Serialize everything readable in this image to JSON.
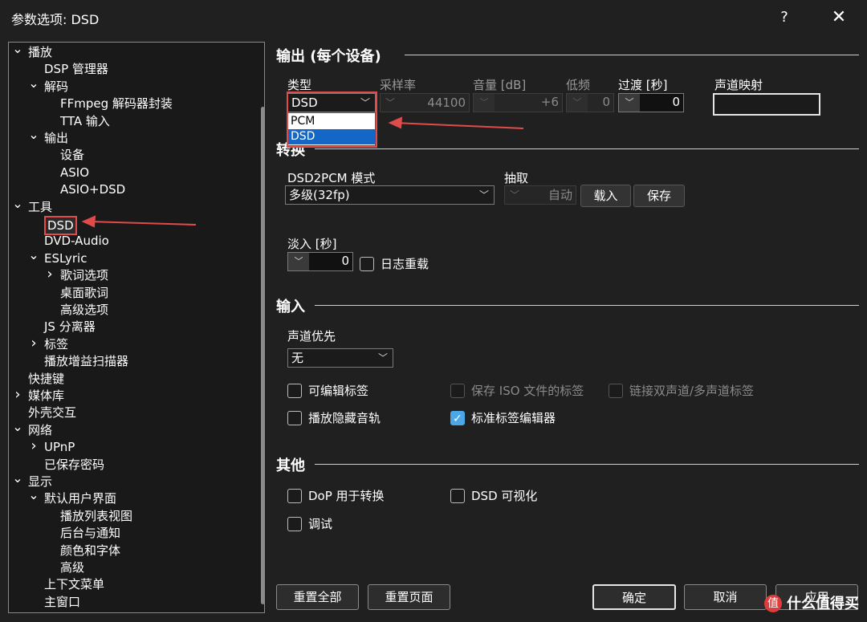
{
  "window": {
    "title": "参数选项: DSD",
    "help": "?",
    "close": "✕"
  },
  "tree": [
    {
      "label": "播放",
      "toggle": "expanded"
    },
    {
      "label": "DSP 管理器",
      "toggle": ""
    },
    {
      "label": "解码",
      "toggle": "expanded"
    },
    {
      "label": "FFmpeg 解码器封装",
      "toggle": ""
    },
    {
      "label": "TTA 输入",
      "toggle": ""
    },
    {
      "label": "输出",
      "toggle": "expanded"
    },
    {
      "label": "设备",
      "toggle": ""
    },
    {
      "label": "ASIO",
      "toggle": ""
    },
    {
      "label": "ASIO+DSD",
      "toggle": ""
    },
    {
      "label": "工具",
      "toggle": "expanded"
    },
    {
      "label": "DSD",
      "toggle": "",
      "selected": true
    },
    {
      "label": "DVD-Audio",
      "toggle": ""
    },
    {
      "label": "ESLyric",
      "toggle": "expanded"
    },
    {
      "label": "歌词选项",
      "toggle": "collapsed"
    },
    {
      "label": "桌面歌词",
      "toggle": ""
    },
    {
      "label": "高级选项",
      "toggle": ""
    },
    {
      "label": "JS 分离器",
      "toggle": ""
    },
    {
      "label": "标签",
      "toggle": "collapsed"
    },
    {
      "label": "播放增益扫描器",
      "toggle": ""
    },
    {
      "label": "快捷键",
      "toggle": ""
    },
    {
      "label": "媒体库",
      "toggle": "collapsed"
    },
    {
      "label": "外壳交互",
      "toggle": ""
    },
    {
      "label": "网络",
      "toggle": "expanded"
    },
    {
      "label": "UPnP",
      "toggle": "collapsed"
    },
    {
      "label": "已保存密码",
      "toggle": ""
    },
    {
      "label": "显示",
      "toggle": "expanded"
    },
    {
      "label": "默认用户界面",
      "toggle": "expanded"
    },
    {
      "label": "播放列表视图",
      "toggle": ""
    },
    {
      "label": "后台与通知",
      "toggle": ""
    },
    {
      "label": "颜色和字体",
      "toggle": ""
    },
    {
      "label": "高级",
      "toggle": ""
    },
    {
      "label": "上下文菜单",
      "toggle": ""
    },
    {
      "label": "主窗口",
      "toggle": ""
    }
  ],
  "output": {
    "heading": "输出 (每个设备)",
    "type_label": "类型",
    "type_value": "DSD",
    "type_options": [
      "PCM",
      "DSD"
    ],
    "samplerate_label": "采样率",
    "samplerate_value": "44100",
    "volume_label": "音量 [dB]",
    "volume_value": "+6",
    "lowfreq_label": "低频",
    "lowfreq_value": "0",
    "transition_label": "过渡 [秒]",
    "transition_value": "0",
    "channelmap_label": "声道映射",
    "channelmap_value": ""
  },
  "convert": {
    "heading": "转换",
    "mode_label": "DSD2PCM 模式",
    "mode_value": "多级(32fp)",
    "decim_label": "抽取",
    "decim_value": "自动",
    "load_button": "载入",
    "save_button": "保存",
    "fadein_label": "淡入 [秒]",
    "fadein_value": "0",
    "log_reload": "日志重载"
  },
  "input": {
    "heading": "输入",
    "channel_priority_label": "声道优先",
    "channel_priority_value": "无",
    "editable_tags": "可编辑标签",
    "save_iso_tags": "保存 ISO 文件的标签",
    "link_tags": "链接双声道/多声道标签",
    "play_hidden": "播放隐藏音轨",
    "std_tag_editor": "标准标签编辑器"
  },
  "other": {
    "heading": "其他",
    "dop": "DoP 用于转换",
    "dsd_vis": "DSD 可视化",
    "debug": "调试"
  },
  "footer": {
    "reset_all": "重置全部",
    "reset_page": "重置页面",
    "ok": "确定",
    "cancel": "取消",
    "apply": "应用"
  },
  "watermark": {
    "text": "什么值得买",
    "icon": "值"
  },
  "colors": {
    "accent": "#1567c7",
    "highlight_red": "#e04b4b",
    "check_blue": "#4aa7e8"
  }
}
